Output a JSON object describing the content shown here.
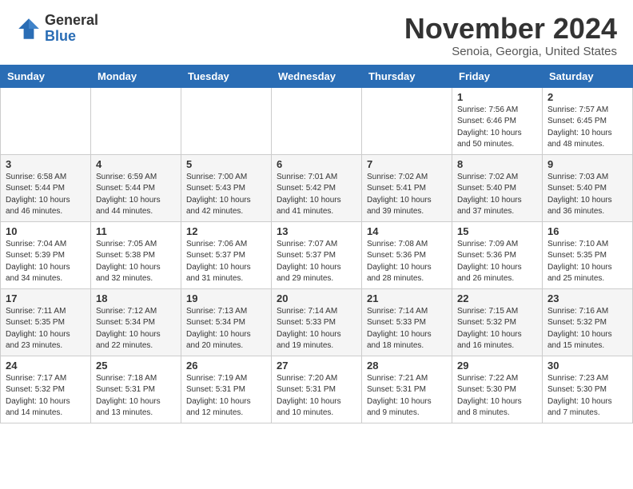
{
  "logo": {
    "general": "General",
    "blue": "Blue"
  },
  "title": "November 2024",
  "location": "Senoia, Georgia, United States",
  "days_header": [
    "Sunday",
    "Monday",
    "Tuesday",
    "Wednesday",
    "Thursday",
    "Friday",
    "Saturday"
  ],
  "weeks": [
    [
      {
        "day": "",
        "info": ""
      },
      {
        "day": "",
        "info": ""
      },
      {
        "day": "",
        "info": ""
      },
      {
        "day": "",
        "info": ""
      },
      {
        "day": "",
        "info": ""
      },
      {
        "day": "1",
        "info": "Sunrise: 7:56 AM\nSunset: 6:46 PM\nDaylight: 10 hours\nand 50 minutes."
      },
      {
        "day": "2",
        "info": "Sunrise: 7:57 AM\nSunset: 6:45 PM\nDaylight: 10 hours\nand 48 minutes."
      }
    ],
    [
      {
        "day": "3",
        "info": "Sunrise: 6:58 AM\nSunset: 5:44 PM\nDaylight: 10 hours\nand 46 minutes."
      },
      {
        "day": "4",
        "info": "Sunrise: 6:59 AM\nSunset: 5:44 PM\nDaylight: 10 hours\nand 44 minutes."
      },
      {
        "day": "5",
        "info": "Sunrise: 7:00 AM\nSunset: 5:43 PM\nDaylight: 10 hours\nand 42 minutes."
      },
      {
        "day": "6",
        "info": "Sunrise: 7:01 AM\nSunset: 5:42 PM\nDaylight: 10 hours\nand 41 minutes."
      },
      {
        "day": "7",
        "info": "Sunrise: 7:02 AM\nSunset: 5:41 PM\nDaylight: 10 hours\nand 39 minutes."
      },
      {
        "day": "8",
        "info": "Sunrise: 7:02 AM\nSunset: 5:40 PM\nDaylight: 10 hours\nand 37 minutes."
      },
      {
        "day": "9",
        "info": "Sunrise: 7:03 AM\nSunset: 5:40 PM\nDaylight: 10 hours\nand 36 minutes."
      }
    ],
    [
      {
        "day": "10",
        "info": "Sunrise: 7:04 AM\nSunset: 5:39 PM\nDaylight: 10 hours\nand 34 minutes."
      },
      {
        "day": "11",
        "info": "Sunrise: 7:05 AM\nSunset: 5:38 PM\nDaylight: 10 hours\nand 32 minutes."
      },
      {
        "day": "12",
        "info": "Sunrise: 7:06 AM\nSunset: 5:37 PM\nDaylight: 10 hours\nand 31 minutes."
      },
      {
        "day": "13",
        "info": "Sunrise: 7:07 AM\nSunset: 5:37 PM\nDaylight: 10 hours\nand 29 minutes."
      },
      {
        "day": "14",
        "info": "Sunrise: 7:08 AM\nSunset: 5:36 PM\nDaylight: 10 hours\nand 28 minutes."
      },
      {
        "day": "15",
        "info": "Sunrise: 7:09 AM\nSunset: 5:36 PM\nDaylight: 10 hours\nand 26 minutes."
      },
      {
        "day": "16",
        "info": "Sunrise: 7:10 AM\nSunset: 5:35 PM\nDaylight: 10 hours\nand 25 minutes."
      }
    ],
    [
      {
        "day": "17",
        "info": "Sunrise: 7:11 AM\nSunset: 5:35 PM\nDaylight: 10 hours\nand 23 minutes."
      },
      {
        "day": "18",
        "info": "Sunrise: 7:12 AM\nSunset: 5:34 PM\nDaylight: 10 hours\nand 22 minutes."
      },
      {
        "day": "19",
        "info": "Sunrise: 7:13 AM\nSunset: 5:34 PM\nDaylight: 10 hours\nand 20 minutes."
      },
      {
        "day": "20",
        "info": "Sunrise: 7:14 AM\nSunset: 5:33 PM\nDaylight: 10 hours\nand 19 minutes."
      },
      {
        "day": "21",
        "info": "Sunrise: 7:14 AM\nSunset: 5:33 PM\nDaylight: 10 hours\nand 18 minutes."
      },
      {
        "day": "22",
        "info": "Sunrise: 7:15 AM\nSunset: 5:32 PM\nDaylight: 10 hours\nand 16 minutes."
      },
      {
        "day": "23",
        "info": "Sunrise: 7:16 AM\nSunset: 5:32 PM\nDaylight: 10 hours\nand 15 minutes."
      }
    ],
    [
      {
        "day": "24",
        "info": "Sunrise: 7:17 AM\nSunset: 5:32 PM\nDaylight: 10 hours\nand 14 minutes."
      },
      {
        "day": "25",
        "info": "Sunrise: 7:18 AM\nSunset: 5:31 PM\nDaylight: 10 hours\nand 13 minutes."
      },
      {
        "day": "26",
        "info": "Sunrise: 7:19 AM\nSunset: 5:31 PM\nDaylight: 10 hours\nand 12 minutes."
      },
      {
        "day": "27",
        "info": "Sunrise: 7:20 AM\nSunset: 5:31 PM\nDaylight: 10 hours\nand 10 minutes."
      },
      {
        "day": "28",
        "info": "Sunrise: 7:21 AM\nSunset: 5:31 PM\nDaylight: 10 hours\nand 9 minutes."
      },
      {
        "day": "29",
        "info": "Sunrise: 7:22 AM\nSunset: 5:30 PM\nDaylight: 10 hours\nand 8 minutes."
      },
      {
        "day": "30",
        "info": "Sunrise: 7:23 AM\nSunset: 5:30 PM\nDaylight: 10 hours\nand 7 minutes."
      }
    ]
  ]
}
